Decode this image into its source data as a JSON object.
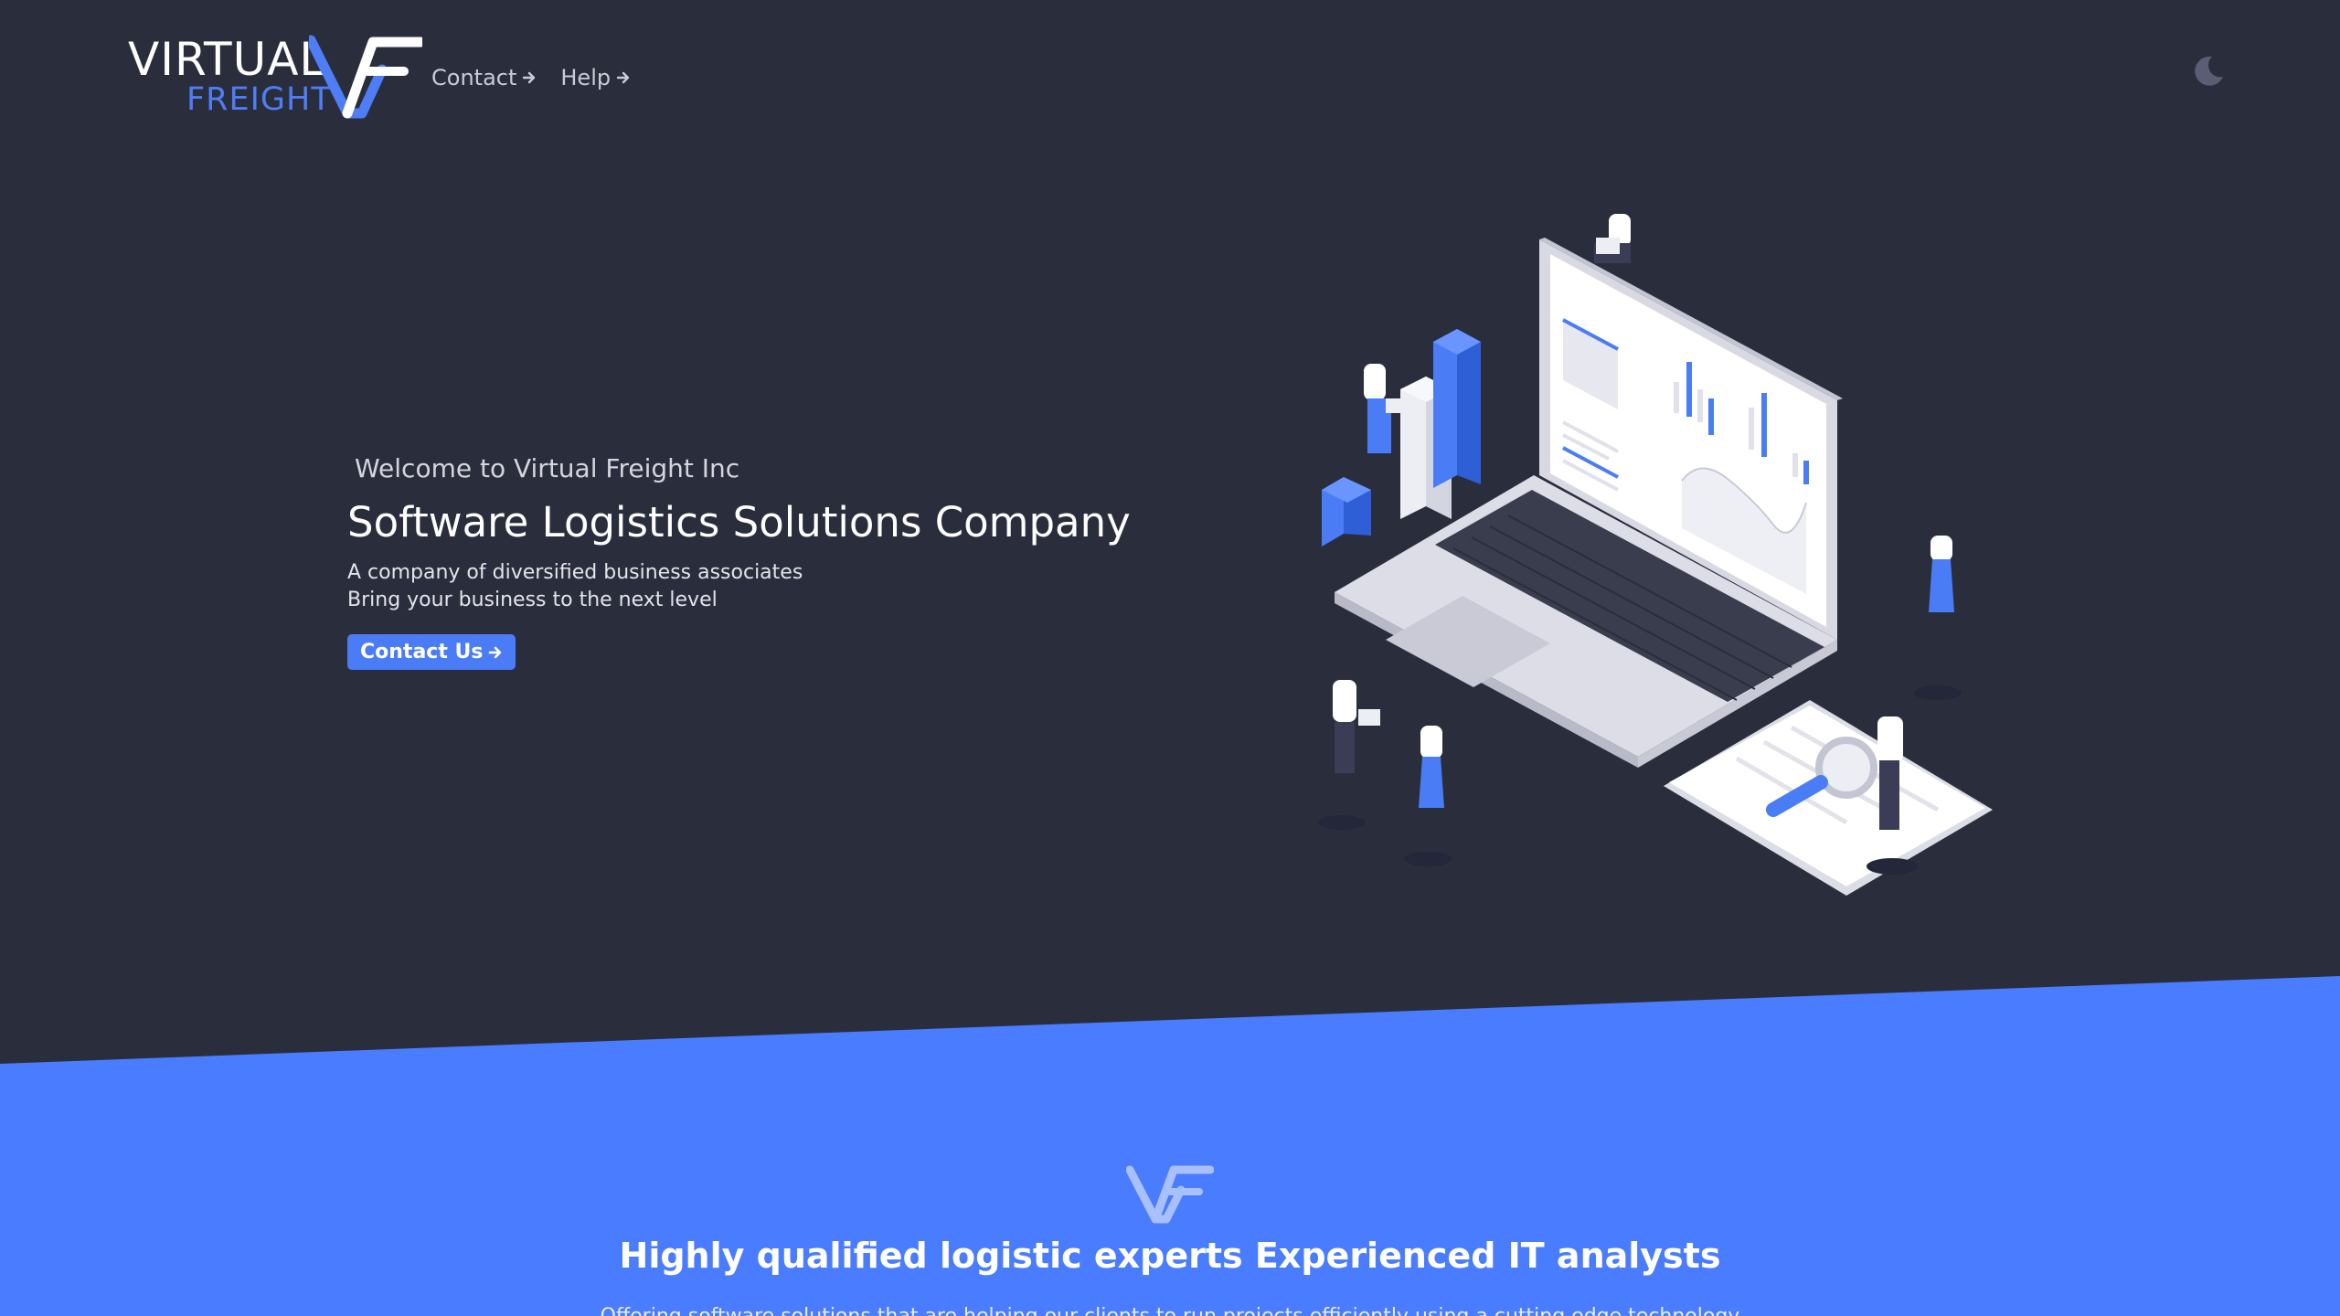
{
  "header": {
    "logo_top": "VIRTUAL",
    "logo_bottom": "FREIGHT",
    "nav": [
      {
        "label": "Contact",
        "icon": "arrow-right-icon"
      },
      {
        "label": "Help",
        "icon": "arrow-right-icon"
      }
    ],
    "theme_toggle_icon": "moon-icon"
  },
  "hero": {
    "welcome": "Welcome to Virtual Freight Inc",
    "title": "Software Logistics Solutions Company",
    "subtitle_1": "A company of diversified business associates",
    "subtitle_2": "Bring your business to the next level",
    "cta_label": "Contact Us",
    "cta_icon": "arrow-right-icon"
  },
  "section": {
    "heading": "Highly qualified logistic experts Experienced IT analysts",
    "text": "Offering software solutions that are helping our clients to run projects efficiently using a cutting edge technology"
  },
  "colors": {
    "background": "#2a2d3c",
    "accent": "#4a7cf6",
    "section_blue": "#4a7cff"
  }
}
